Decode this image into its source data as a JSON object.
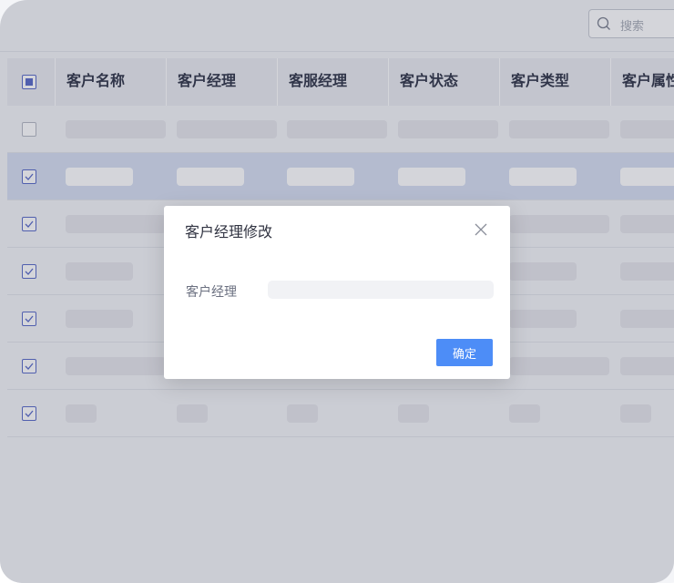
{
  "search": {
    "placeholder": "搜索"
  },
  "table": {
    "columns": [
      "客户名称",
      "客户经理",
      "客服经理",
      "客户状态",
      "客户类型",
      "客户属性"
    ],
    "rows": [
      {
        "checked": false,
        "selected": false
      },
      {
        "checked": true,
        "selected": true
      },
      {
        "checked": true,
        "selected": false
      },
      {
        "checked": true,
        "selected": false
      },
      {
        "checked": true,
        "selected": false
      },
      {
        "checked": true,
        "selected": false
      },
      {
        "checked": true,
        "selected": false
      }
    ]
  },
  "dialog": {
    "title": "客户经理修改",
    "field_label": "客户经理",
    "field_value": "",
    "ok_label": "确定"
  },
  "colors": {
    "accent": "#4d8df7",
    "checkbox_accent": "#5b6cc9",
    "selected_row": "#d7dff2"
  }
}
